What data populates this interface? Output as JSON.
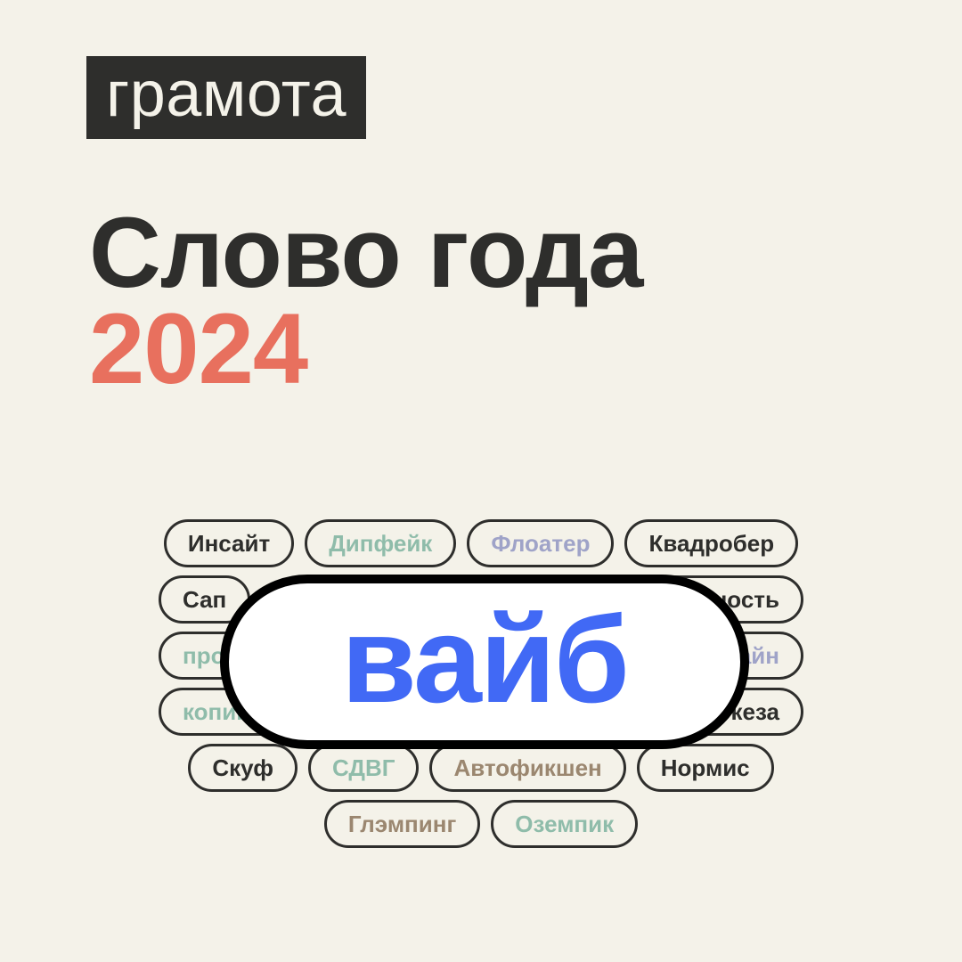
{
  "meta": {
    "background_color": "#F4F2E9",
    "ink_color": "#2E2E2C",
    "accent_color": "#E8705E",
    "winner_color": "#4169F5",
    "teal_color": "#8FBCAA",
    "purple_color": "#9FA3C8",
    "brown_color": "#9B8770"
  },
  "brand": {
    "logo_text": "грамота"
  },
  "headline": {
    "title": "Слово года",
    "year": "2024"
  },
  "winner": {
    "word": "вайб"
  },
  "word_cloud": {
    "rows": [
      {
        "chips": [
          {
            "label": "Инсайт",
            "color": "dark"
          },
          {
            "label": "Дипфейк",
            "color": "teal"
          },
          {
            "label": "Флоатер",
            "color": "purple"
          },
          {
            "label": "Квадробер",
            "color": "dark"
          }
        ]
      },
      {
        "chips": [
          {
            "label": "Сап",
            "color": "dark"
          },
          {
            "label": "Осознанность",
            "color": "dark"
          }
        ]
      },
      {
        "chips": [
          {
            "label": "прокрастинация",
            "color": "teal"
          },
          {
            "label": "Аджайн",
            "color": "purple"
          }
        ]
      },
      {
        "chips": [
          {
            "label": "копипаста",
            "color": "teal"
          },
          {
            "label": "Брокеза",
            "color": "dark"
          }
        ]
      },
      {
        "chips": [
          {
            "label": "Скуф",
            "color": "dark"
          },
          {
            "label": "СДВГ",
            "color": "teal"
          },
          {
            "label": "Автофикшен",
            "color": "brown"
          },
          {
            "label": "Нормис",
            "color": "dark"
          }
        ]
      },
      {
        "chips": [
          {
            "label": "Глэмпинг",
            "color": "brown"
          },
          {
            "label": "Оземпик",
            "color": "teal"
          }
        ]
      }
    ]
  }
}
